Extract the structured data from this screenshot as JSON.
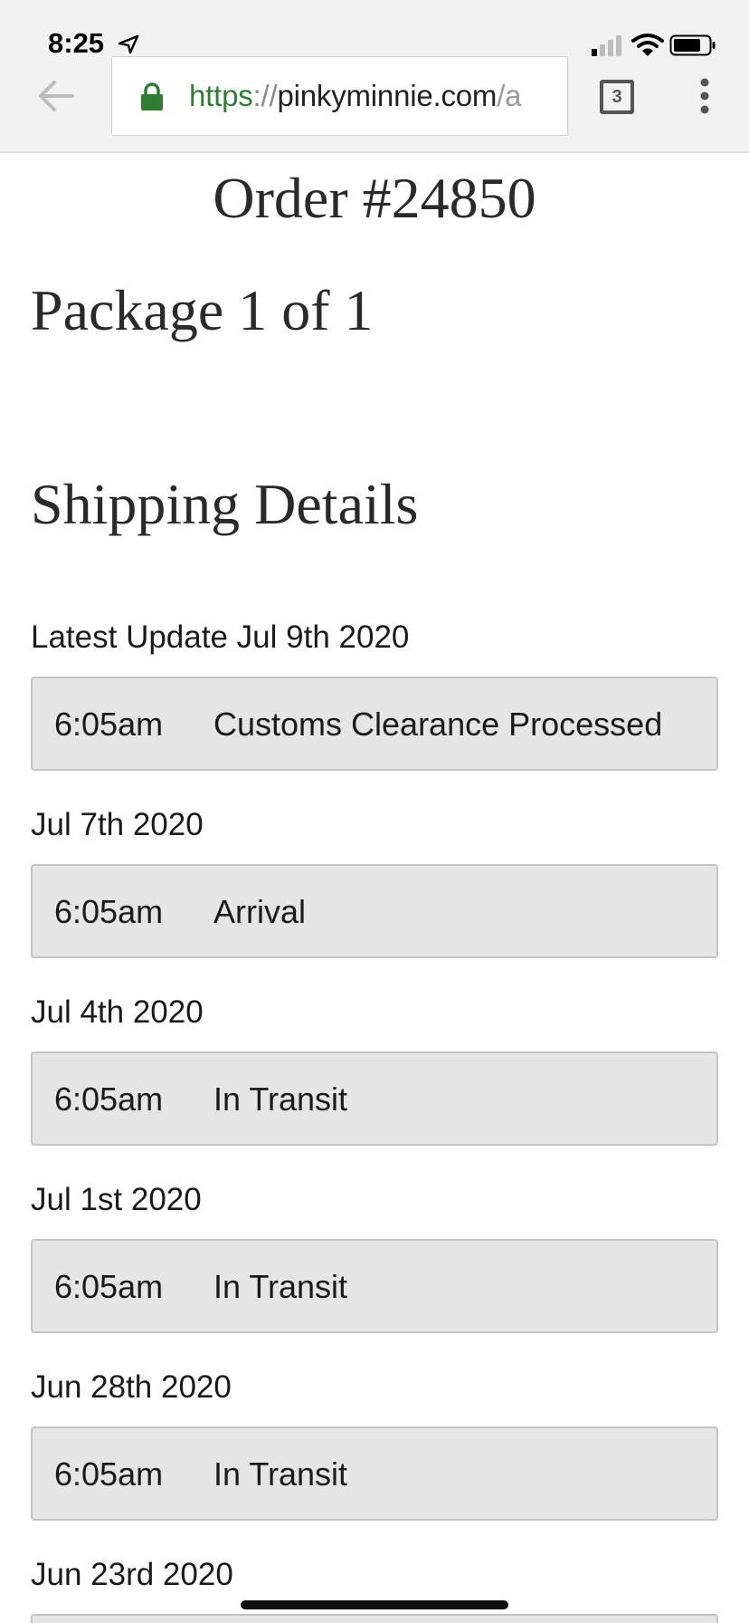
{
  "status_bar": {
    "time": "8:25",
    "icons": [
      "location-arrow-icon",
      "signal-icon",
      "wifi-icon",
      "battery-icon"
    ]
  },
  "browser": {
    "url_protocol": "https",
    "url_separator": "://",
    "url_host": "pinkyminnie.com",
    "url_rest": "/a",
    "tab_count": "3",
    "secure_color": "#2e7d32",
    "icons": [
      "back-arrow-icon",
      "lock-icon",
      "tabs-icon",
      "more-vert-icon"
    ]
  },
  "page": {
    "title": "Order #24850",
    "package": "Package 1 of 1",
    "section_title": "Shipping Details",
    "latest_prefix": "Latest Update",
    "events": [
      {
        "date": "Jul 9th 2020",
        "time": "6:05am",
        "status": "Customs Clearance Processed"
      },
      {
        "date": "Jul 7th 2020",
        "time": "6:05am",
        "status": "Arrival"
      },
      {
        "date": "Jul 4th 2020",
        "time": "6:05am",
        "status": "In Transit"
      },
      {
        "date": "Jul 1st 2020",
        "time": "6:05am",
        "status": "In Transit"
      },
      {
        "date": "Jun 28th 2020",
        "time": "6:05am",
        "status": "In Transit"
      },
      {
        "date": "Jun 23rd 2020"
      }
    ]
  },
  "colors": {
    "event_bg": "#e5e5e5",
    "event_border": "#c4c4c4",
    "chrome_bg": "#f2f2f2"
  }
}
